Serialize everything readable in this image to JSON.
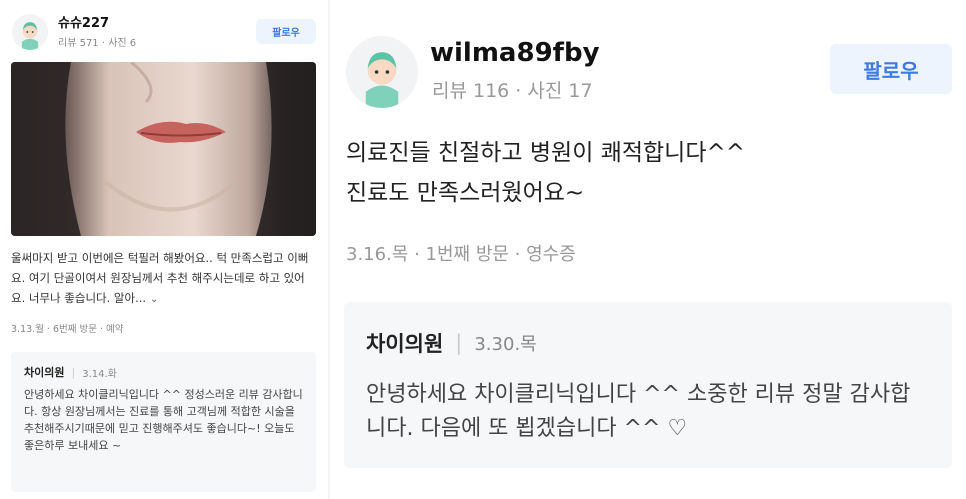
{
  "left_review": {
    "username": "슈슈227",
    "stats": "리뷰 571 · 사진 6",
    "follow_label": "팔로우",
    "body": "울써마지 받고 이번에은 턱필러 해봤어요.. 턱 만족스럽고 이뻐요. 여기 단골이여서 원장님께서 추천 해주시는데로 하고 있어요. 너무나 좋습니다. 알아...",
    "more_icon": "chevron-down-icon",
    "visit_info": "3.13.월 · 6번째 방문 · 예약",
    "reply": {
      "owner": "차이의원",
      "date": "3.14.화",
      "text": "안녕하세요 차이클리닉입니다 ^^ 정성스러운 리뷰 감사합니다. 항상 원장님께서는 진료를 통해 고객님께 적합한 시술을 추천해주시기때문에 믿고 진행해주셔도 좋습니다~! 오늘도 좋은하루 보내세요 ~"
    }
  },
  "right_review": {
    "username": "wilma89fby",
    "stats": "리뷰 116 · 사진 17",
    "follow_label": "팔로우",
    "body_line1": "의료진들 친절하고 병원이 쾌적합니다^^",
    "body_line2": "진료도 만족스러웠어요~",
    "visit_info": "3.16.목 · 1번째 방문 · 영수증",
    "reply": {
      "owner": "차이의원",
      "date": "3.30.목",
      "text": "안녕하세요 차이클리닉입니다 ^^ 소중한 리뷰 정말 감사합니다. 다음에 또 뵙겠습니다 ^^ ♡"
    }
  },
  "colors": {
    "follow_text": "#3d7be0",
    "follow_bg": "#eef4fd",
    "reply_bg": "#f6f7f8",
    "avatar_hair": "#7fd1b9"
  }
}
